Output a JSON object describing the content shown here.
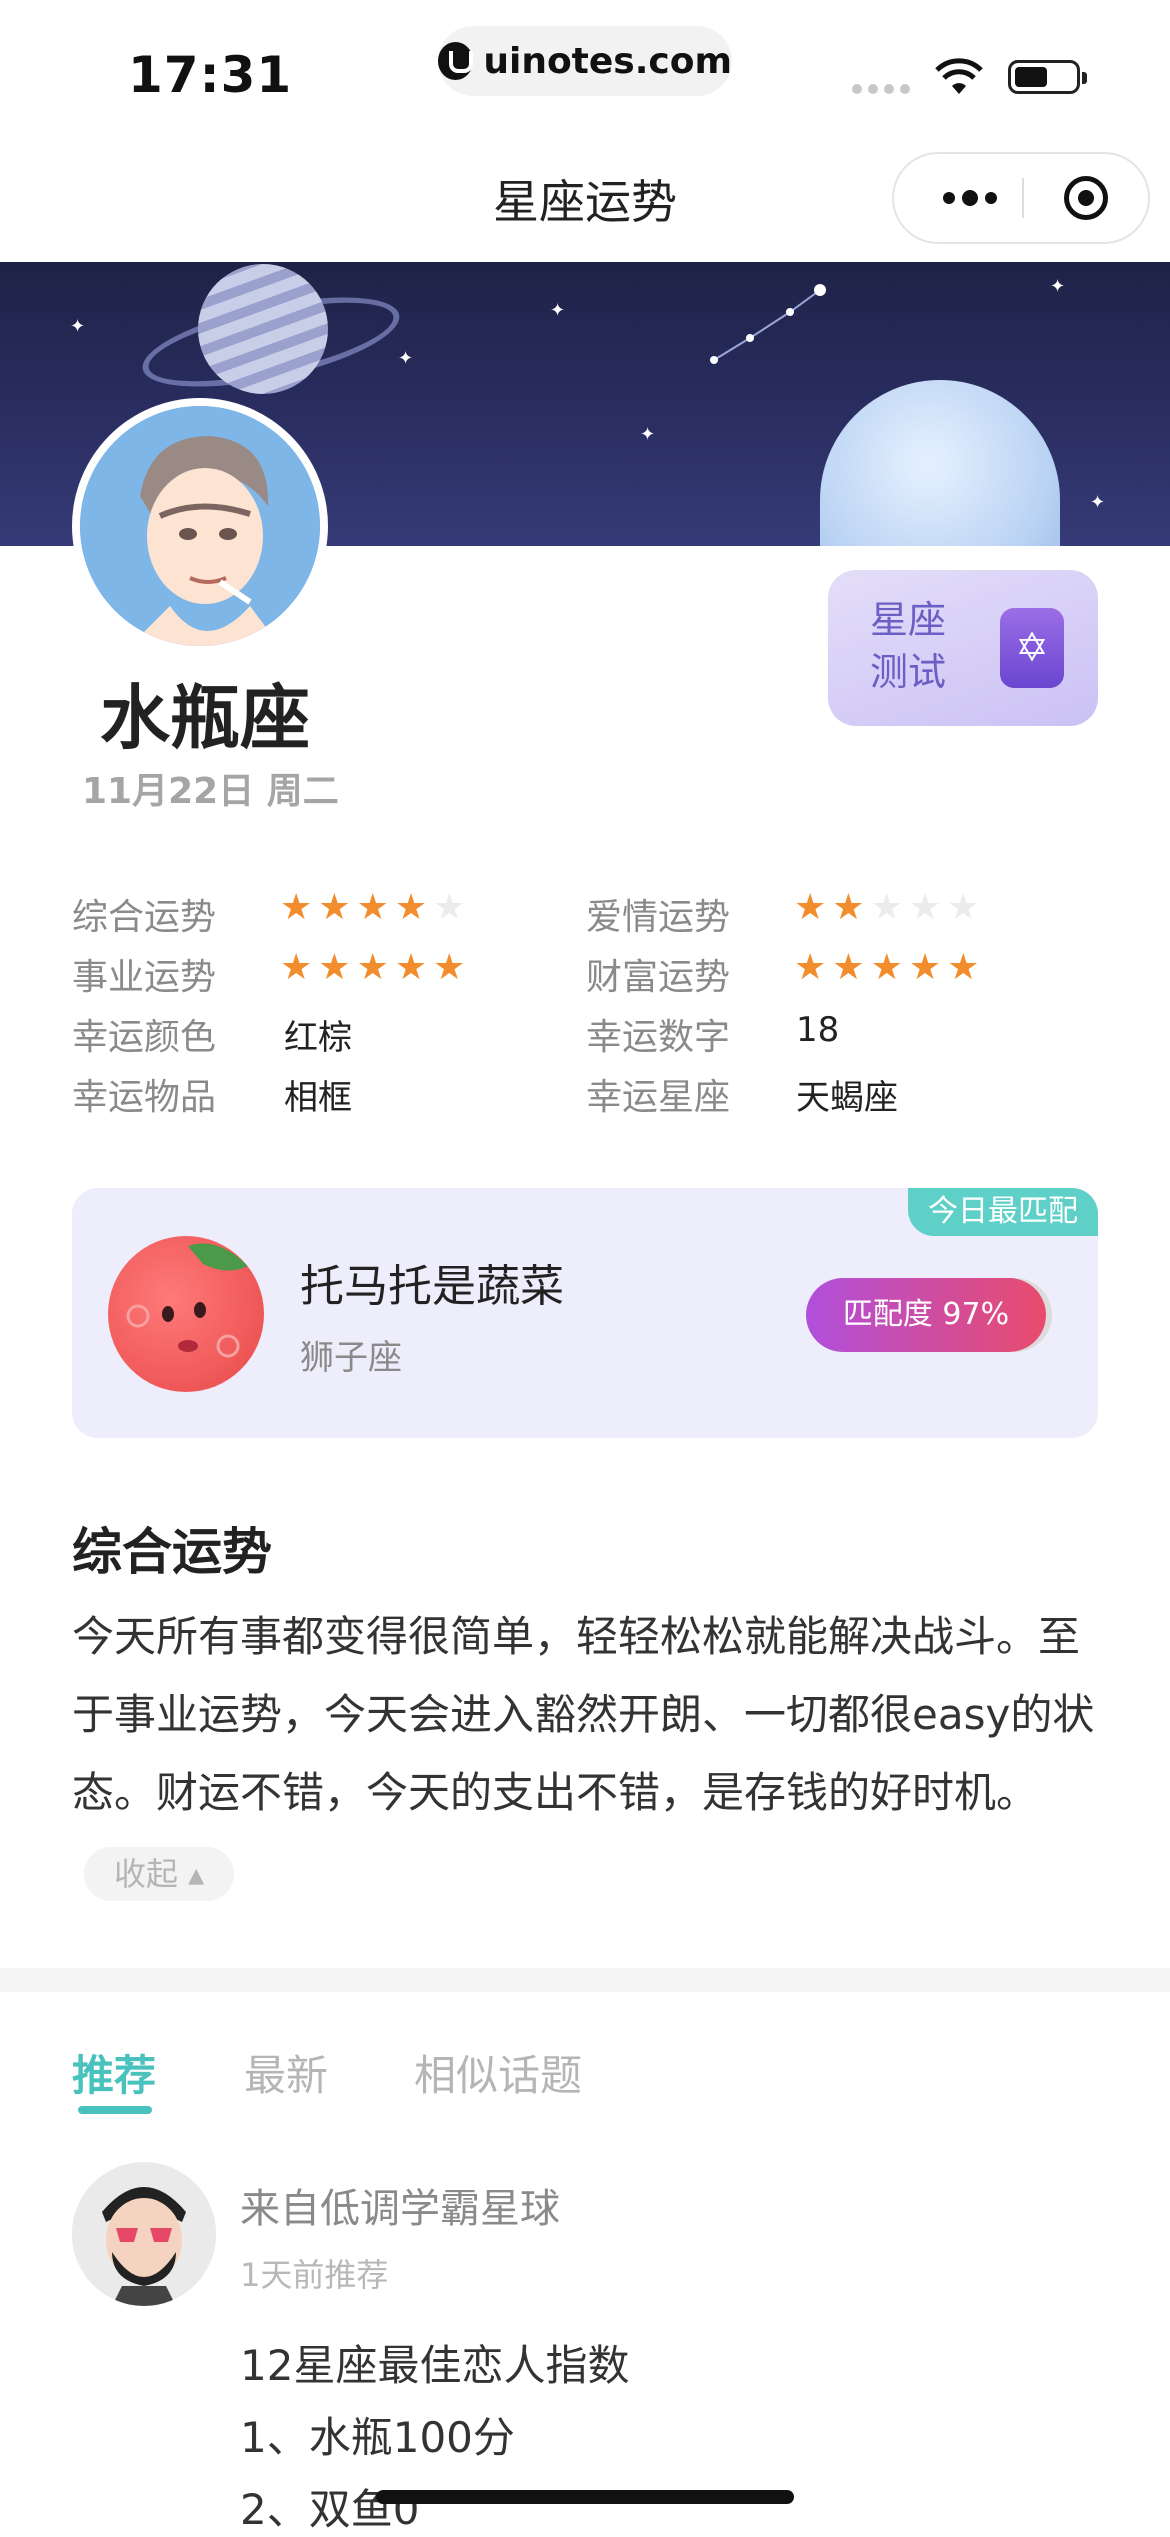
{
  "status_bar": {
    "time": "17:31",
    "url": "uinotes.com"
  },
  "nav": {
    "title": "星座运势"
  },
  "profile": {
    "sign": "水瓶座",
    "date": "11月22日 周二"
  },
  "test_button": {
    "label": "星座测试",
    "icon": "star-of-david-icon"
  },
  "fortune": {
    "overall": {
      "label": "综合运势",
      "rating": 4,
      "max": 5
    },
    "love": {
      "label": "爱情运势",
      "rating": 2,
      "max": 5
    },
    "career": {
      "label": "事业运势",
      "rating": 5,
      "max": 5
    },
    "wealth": {
      "label": "财富运势",
      "rating": 5,
      "max": 5
    },
    "lucky_color": {
      "label": "幸运颜色",
      "value": "红棕"
    },
    "lucky_number": {
      "label": "幸运数字",
      "value": "18"
    },
    "lucky_item": {
      "label": "幸运物品",
      "value": "相框"
    },
    "lucky_sign": {
      "label": "幸运星座",
      "value": "天蝎座"
    }
  },
  "match": {
    "tag": "今日最匹配",
    "name": "托马托是蔬菜",
    "sign": "狮子座",
    "score": "匹配度 97%"
  },
  "general": {
    "title": "综合运势",
    "text": "今天所有事都变得很简单，轻轻松松就能解决战斗。至于事业运势，今天会进入豁然开朗、一切都很easy的状态。财运不错，今天的支出不错，是存钱的好时机。",
    "collapse": "收起 ▴"
  },
  "tabs": [
    {
      "label": "推荐",
      "active": true
    },
    {
      "label": "最新",
      "active": false
    },
    {
      "label": "相似话题",
      "active": false
    }
  ],
  "post": {
    "from": "来自低调学霸星球",
    "time": "1天前推荐",
    "lines": [
      "12星座最佳恋人指数",
      "1、水瓶100分",
      "2、双鱼0"
    ]
  },
  "colors": {
    "accent": "#49c2bd",
    "star": "#f28d2e",
    "match_gradient_start": "#b04fdc",
    "match_gradient_end": "#e94b6c"
  }
}
